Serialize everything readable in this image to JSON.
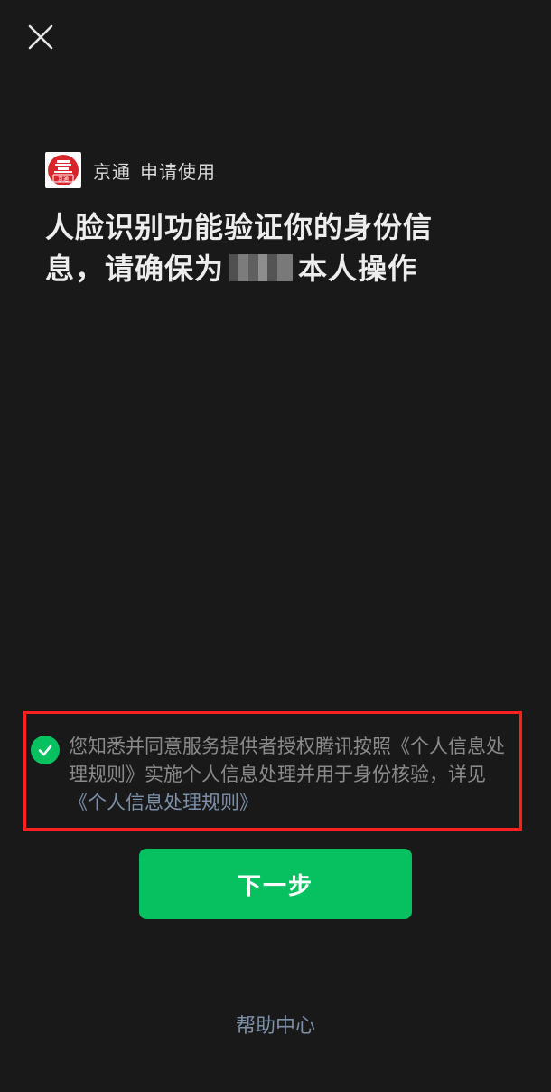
{
  "close_icon": "close-icon",
  "app": {
    "logo_icon": "jingtong-logo",
    "logo_text": "京通",
    "name": "京通",
    "action": "申请使用"
  },
  "headline": {
    "line1": "人脸识别功能验证你的身份信",
    "line2_prefix": "息，请确保为",
    "line2_suffix": "本人操作"
  },
  "consent": {
    "checked": true,
    "text": "您知悉并同意服务提供者授权腾讯按照《个人信息处理规则》实施个人信息处理并用于身份核验，详见",
    "link": "《个人信息处理规则》"
  },
  "next_button": "下一步",
  "help_link": "帮助中心",
  "colors": {
    "background": "#191919",
    "accent_green": "#07c160",
    "link_blue": "#7d90a9",
    "highlight_red": "#ff2020"
  }
}
